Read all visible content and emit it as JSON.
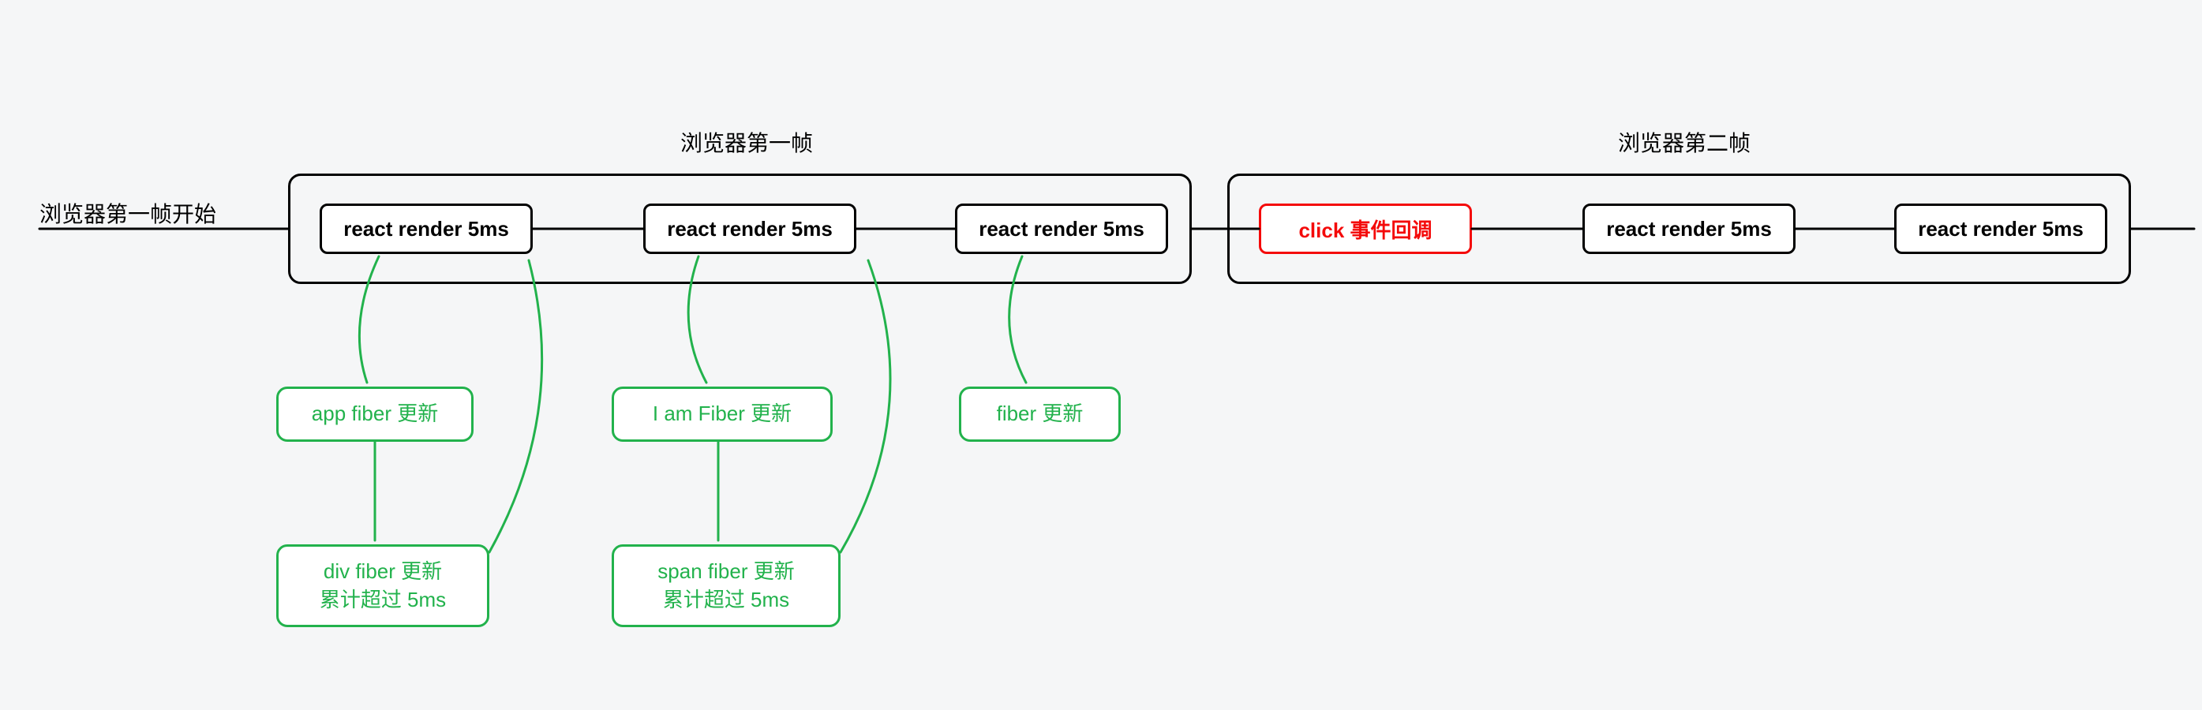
{
  "timeline": {
    "start_label": "浏览器第一帧开始",
    "frame1": {
      "title": "浏览器第一帧",
      "slots": [
        {
          "label": "react render 5ms"
        },
        {
          "label": "react render 5ms"
        },
        {
          "label": "react render 5ms"
        }
      ]
    },
    "frame2": {
      "title": "浏览器第二帧",
      "slots": [
        {
          "label": "click 事件回调",
          "highlight": true
        },
        {
          "label": "react render 5ms"
        },
        {
          "label": "react render 5ms"
        }
      ]
    }
  },
  "detail": {
    "chain1": {
      "top": "app fiber 更新",
      "bottom": "div fiber 更新\n累计超过 5ms"
    },
    "chain2": {
      "top": "I am Fiber 更新",
      "bottom": "span fiber 更新\n累计超过 5ms"
    },
    "chain3": {
      "top": "fiber 更新"
    }
  },
  "colors": {
    "green": "#22b24c",
    "red": "#f40a0a",
    "black": "#000000"
  }
}
